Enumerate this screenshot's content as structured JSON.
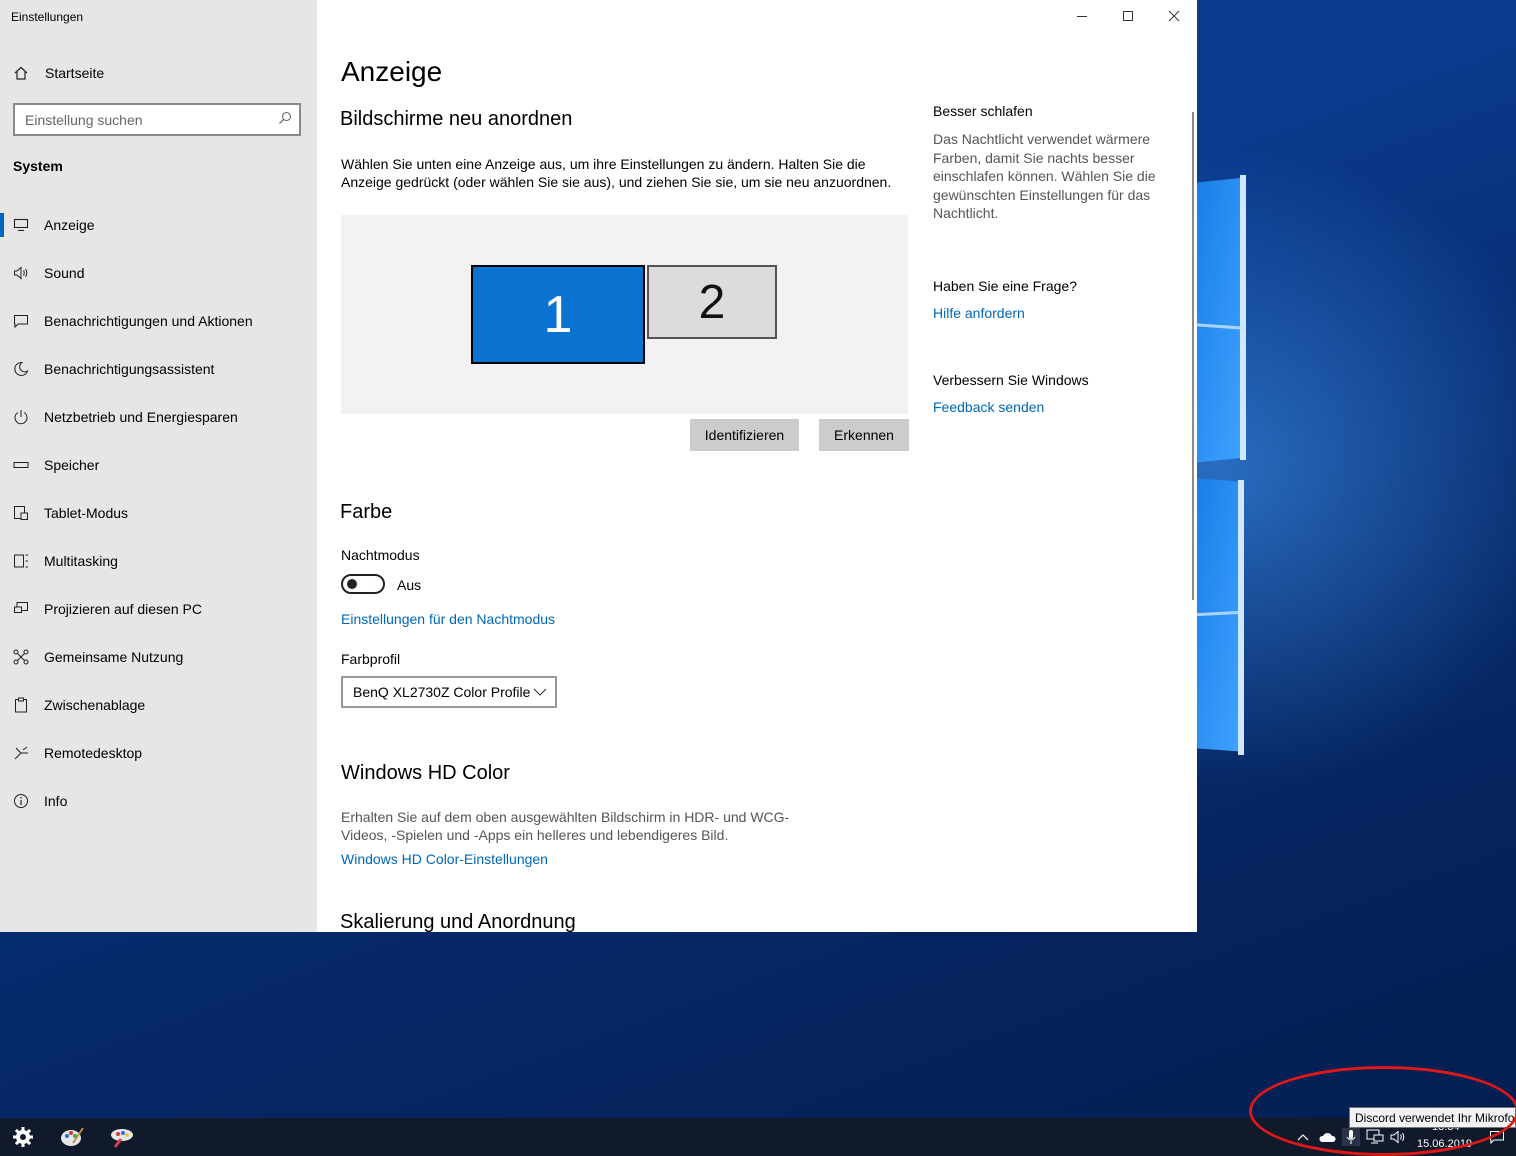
{
  "window": {
    "app_title": "Einstellungen",
    "controls": {
      "minimize": "—",
      "maximize": "☐",
      "close": "✕"
    }
  },
  "sidebar": {
    "home_label": "Startseite",
    "search_placeholder": "Einstellung suchen",
    "section": "System",
    "items": [
      {
        "label": "Anzeige",
        "icon": "monitor-icon",
        "active": true
      },
      {
        "label": "Sound",
        "icon": "speaker-icon"
      },
      {
        "label": "Benachrichtigungen und Aktionen",
        "icon": "message-icon"
      },
      {
        "label": "Benachrichtigungsassistent",
        "icon": "moon-icon"
      },
      {
        "label": "Netzbetrieb und Energiesparen",
        "icon": "power-icon"
      },
      {
        "label": "Speicher",
        "icon": "storage-icon"
      },
      {
        "label": "Tablet-Modus",
        "icon": "tablet-icon"
      },
      {
        "label": "Multitasking",
        "icon": "multitasking-icon"
      },
      {
        "label": "Projizieren auf diesen PC",
        "icon": "project-icon"
      },
      {
        "label": "Gemeinsame Nutzung",
        "icon": "shared-icon"
      },
      {
        "label": "Zwischenablage",
        "icon": "clipboard-icon"
      },
      {
        "label": "Remotedesktop",
        "icon": "remote-icon"
      },
      {
        "label": "Info",
        "icon": "info-icon"
      }
    ]
  },
  "main": {
    "title": "Anzeige",
    "rearrange": {
      "heading": "Bildschirme neu anordnen",
      "description": "Wählen Sie unten eine Anzeige aus, um ihre Einstellungen zu ändern. Halten Sie die Anzeige gedrückt (oder wählen Sie sie aus), und ziehen Sie sie, um sie neu anzuordnen.",
      "monitor_1": "1",
      "monitor_2": "2",
      "identify_button": "Identifizieren",
      "detect_button": "Erkennen"
    },
    "color": {
      "heading": "Farbe",
      "night_mode_label": "Nachtmodus",
      "night_mode_state": "Aus",
      "night_mode_settings_link": "Einstellungen für den Nachtmodus",
      "profile_label": "Farbprofil",
      "profile_value": "BenQ XL2730Z Color Profile"
    },
    "hd_color": {
      "heading": "Windows HD Color",
      "description": "Erhalten Sie auf dem oben ausgewählten Bildschirm in HDR- und WCG-Videos, -Spielen und -Apps ein helleres und lebendigeres Bild.",
      "link": "Windows HD Color-Einstellungen"
    },
    "scaling": {
      "heading": "Skalierung und Anordnung"
    }
  },
  "right": {
    "sleep_heading": "Besser schlafen",
    "sleep_text": "Das Nachtlicht verwendet wärmere Farben, damit Sie nachts besser einschlafen können. Wählen Sie die gewünschten Einstellungen für das Nachtlicht.",
    "question_heading": "Haben Sie eine Frage?",
    "help_link": "Hilfe anfordern",
    "improve_heading": "Verbessern Sie Windows",
    "feedback_link": "Feedback senden"
  },
  "taskbar": {
    "tooltip": "Discord verwendet Ihr Mikrofo",
    "time": "13:34",
    "date": "15.06.2019"
  },
  "colors": {
    "accent": "#0067b8",
    "monitor_selected": "#0a73d1",
    "sidebar_bg": "#e6e6e6",
    "annotation": "#e01818"
  }
}
